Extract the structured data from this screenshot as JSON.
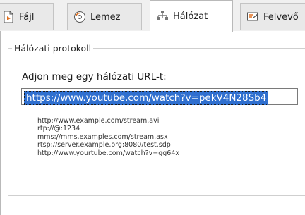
{
  "tabs": [
    {
      "label": "Fájl",
      "icon": "file-play-icon",
      "active": false
    },
    {
      "label": "Lemez",
      "icon": "disc-icon",
      "active": false
    },
    {
      "label": "Hálózat",
      "icon": "network-icon",
      "active": true
    },
    {
      "label": "Felvevő",
      "icon": "capture-device-icon",
      "active": false
    }
  ],
  "network": {
    "group_title": "Hálózati protokoll",
    "prompt": "Adjon meg egy hálózati URL-t:",
    "url_value": "https://www.youtube.com/watch?v=pekV4N28Sb4",
    "examples": [
      "http://www.example.com/stream.avi",
      "rtp://@:1234",
      "mms://mms.examples.com/stream.asx",
      "rtsp://server.example.org:8080/test.sdp",
      "http://www.yourtube.com/watch?v=gg64x"
    ]
  },
  "colors": {
    "selection": "#2f6fcf",
    "window_bg": "#f0f0f0",
    "panel_bg": "#ffffff"
  }
}
